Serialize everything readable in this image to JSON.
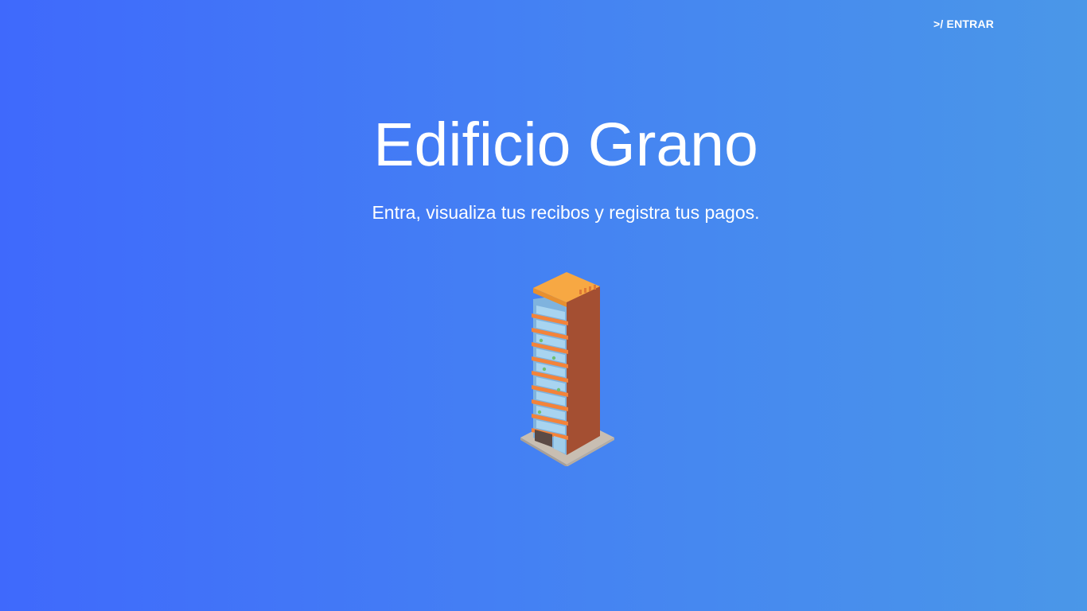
{
  "nav": {
    "login_label": ">/ ENTRAR"
  },
  "hero": {
    "title": "Edificio Grano",
    "subtitle": "Entra, visualiza tus recibos y registra tus pagos."
  },
  "illustration": {
    "icon": "building-illustration",
    "colors": {
      "roof": "#f7a843",
      "side_wall": "#a44f32",
      "balcony": "#f3833a",
      "glass": "#a8d4f0",
      "base": "#c8beb2"
    }
  },
  "theme": {
    "gradient_start": "#3f69fc",
    "gradient_end": "#4a97e8",
    "text": "#ffffff"
  }
}
